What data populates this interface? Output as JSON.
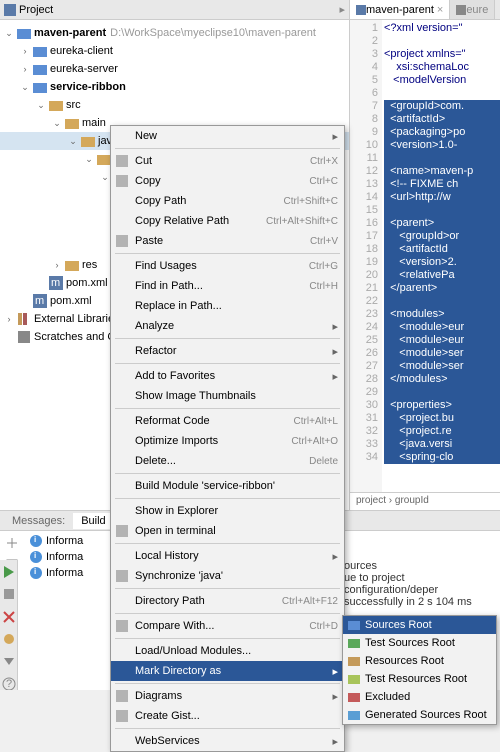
{
  "project_tab": "Project",
  "tree": {
    "root": "maven-parent",
    "root_path": "D:\\WorkSpace\\myeclipse10\\maven-parent",
    "children": [
      "eureka-client",
      "eureka-server",
      "service-ribbon"
    ],
    "src": "src",
    "main": "main",
    "java": "java",
    "res": "res",
    "pom1": "pom.xml",
    "pom2": "pom.xml",
    "ext": "External Libraries",
    "scratch": "Scratches and Co"
  },
  "editor": {
    "tab1": "maven-parent",
    "tab2": "eure",
    "breadcrumb": "project  ›  groupId",
    "lines": [
      "1",
      "2",
      "3",
      "4",
      "5",
      "6",
      "7",
      "8",
      "9",
      "10",
      "11",
      "12",
      "13",
      "14",
      "15",
      "16",
      "17",
      "18",
      "19",
      "20",
      "21",
      "22",
      "23",
      "24",
      "25",
      "26",
      "27",
      "28",
      "29",
      "30",
      "31",
      "32",
      "33",
      "34"
    ],
    "code_plain1": "<?xml version=\"",
    "code_plain2": "<project xmlns=\"",
    "code_plain3": "    xsi:schemaLoc",
    "code_plain4": "   <modelVersion",
    "highlighted": [
      "<groupId>com.",
      "<artifactId>",
      "<packaging>po",
      "<version>1.0-",
      "",
      "<name>maven-p",
      "<!-- FIXME ch",
      "<url>http://w",
      "",
      "<parent>",
      "   <groupId>or",
      "   <artifactId",
      "   <version>2.",
      "   <relativePa",
      "</parent>",
      "",
      "<modules>",
      "   <module>eur",
      "   <module>eur",
      "   <module>ser",
      "   <module>ser",
      "</modules>",
      "",
      "<properties>",
      "   <project.bu",
      "   <project.re",
      "   <java.versi",
      "   <spring-clo"
    ]
  },
  "menu": [
    {
      "label": "New",
      "shortcut": "",
      "arrow": true
    },
    {
      "sep": true
    },
    {
      "label": "Cut",
      "shortcut": "Ctrl+X",
      "icon": "cut"
    },
    {
      "label": "Copy",
      "shortcut": "Ctrl+C",
      "icon": "copy"
    },
    {
      "label": "Copy Path",
      "shortcut": "Ctrl+Shift+C"
    },
    {
      "label": "Copy Relative Path",
      "shortcut": "Ctrl+Alt+Shift+C"
    },
    {
      "label": "Paste",
      "shortcut": "Ctrl+V",
      "icon": "paste"
    },
    {
      "sep": true
    },
    {
      "label": "Find Usages",
      "shortcut": "Ctrl+G"
    },
    {
      "label": "Find in Path...",
      "shortcut": "Ctrl+H"
    },
    {
      "label": "Replace in Path...",
      "shortcut": ""
    },
    {
      "label": "Analyze",
      "shortcut": "",
      "arrow": true
    },
    {
      "sep": true
    },
    {
      "label": "Refactor",
      "shortcut": "",
      "arrow": true
    },
    {
      "sep": true
    },
    {
      "label": "Add to Favorites",
      "shortcut": "",
      "arrow": true
    },
    {
      "label": "Show Image Thumbnails",
      "shortcut": ""
    },
    {
      "sep": true
    },
    {
      "label": "Reformat Code",
      "shortcut": "Ctrl+Alt+L"
    },
    {
      "label": "Optimize Imports",
      "shortcut": "Ctrl+Alt+O"
    },
    {
      "label": "Delete...",
      "shortcut": "Delete"
    },
    {
      "sep": true
    },
    {
      "label": "Build Module 'service-ribbon'",
      "shortcut": ""
    },
    {
      "sep": true
    },
    {
      "label": "Show in Explorer",
      "shortcut": ""
    },
    {
      "label": "Open in terminal",
      "shortcut": "",
      "icon": "term"
    },
    {
      "sep": true
    },
    {
      "label": "Local History",
      "shortcut": "",
      "arrow": true
    },
    {
      "label": "Synchronize 'java'",
      "shortcut": "",
      "icon": "sync"
    },
    {
      "sep": true
    },
    {
      "label": "Directory Path",
      "shortcut": "Ctrl+Alt+F12"
    },
    {
      "sep": true
    },
    {
      "label": "Compare With...",
      "shortcut": "Ctrl+D",
      "icon": "diff"
    },
    {
      "sep": true
    },
    {
      "label": "Load/Unload Modules...",
      "shortcut": ""
    },
    {
      "label": "Mark Directory as",
      "shortcut": "",
      "arrow": true,
      "selected": true
    },
    {
      "sep": true
    },
    {
      "label": "Diagrams",
      "shortcut": "",
      "arrow": true,
      "icon": "diag"
    },
    {
      "label": "Create Gist...",
      "shortcut": "",
      "icon": "gist"
    },
    {
      "sep": true
    },
    {
      "label": "WebServices",
      "shortcut": "",
      "arrow": true
    }
  ],
  "submenu": [
    {
      "label": "Sources Root",
      "color": "#5a8dd4",
      "selected": true
    },
    {
      "label": "Test Sources Root",
      "color": "#5aa85a"
    },
    {
      "label": "Resources Root",
      "color": "#c49a5a"
    },
    {
      "label": "Test Resources Root",
      "color": "#a8c45a"
    },
    {
      "label": "Excluded",
      "color": "#c45a5a"
    },
    {
      "label": "Generated Sources Root",
      "color": "#5a9ed4"
    }
  ],
  "messages": {
    "tab1": "Messages:",
    "tab2": "Build",
    "rows": [
      "Informa",
      "Informa",
      "Informa"
    ],
    "text1": "ources",
    "text2": "ue to project configuration/deper",
    "text3": "successfully in 2 s 104 ms"
  }
}
